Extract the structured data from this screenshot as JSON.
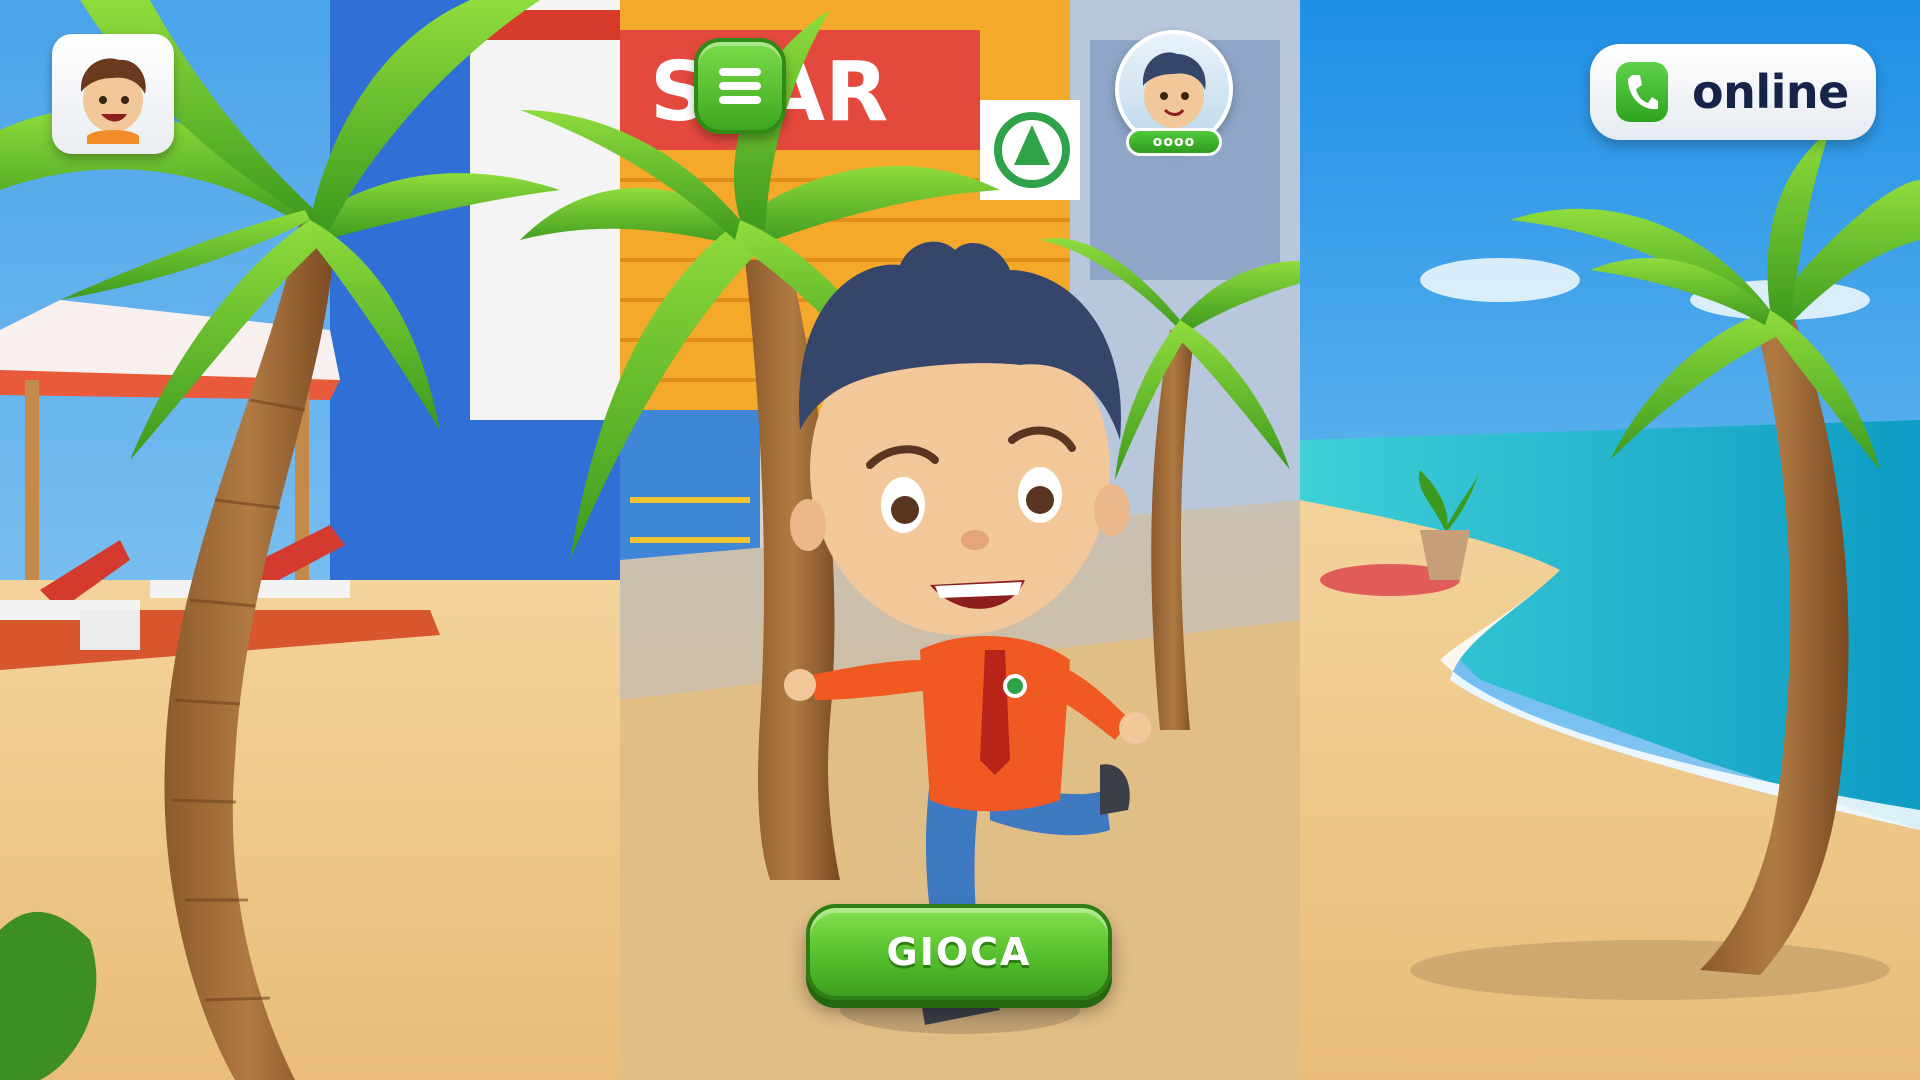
{
  "hud": {
    "profile_icon": "boy-avatar-icon",
    "menu_icon": "hamburger-menu-icon",
    "player_tag": "oooo",
    "online_icon": "phone-icon",
    "online_label": "online",
    "play_label": "GIOCA"
  },
  "scene": {
    "store_sign": "SPAR",
    "left_bg": "beach with sun loungers and palm tree",
    "center_bg": "supermarket front with palm trees and running boy character",
    "right_bg": "sea shore with palm tree"
  },
  "colors": {
    "accent_green": "#4fb828",
    "sky": "#6ab7ee",
    "sand": "#efc88c",
    "sea": "#1fb3c8"
  }
}
